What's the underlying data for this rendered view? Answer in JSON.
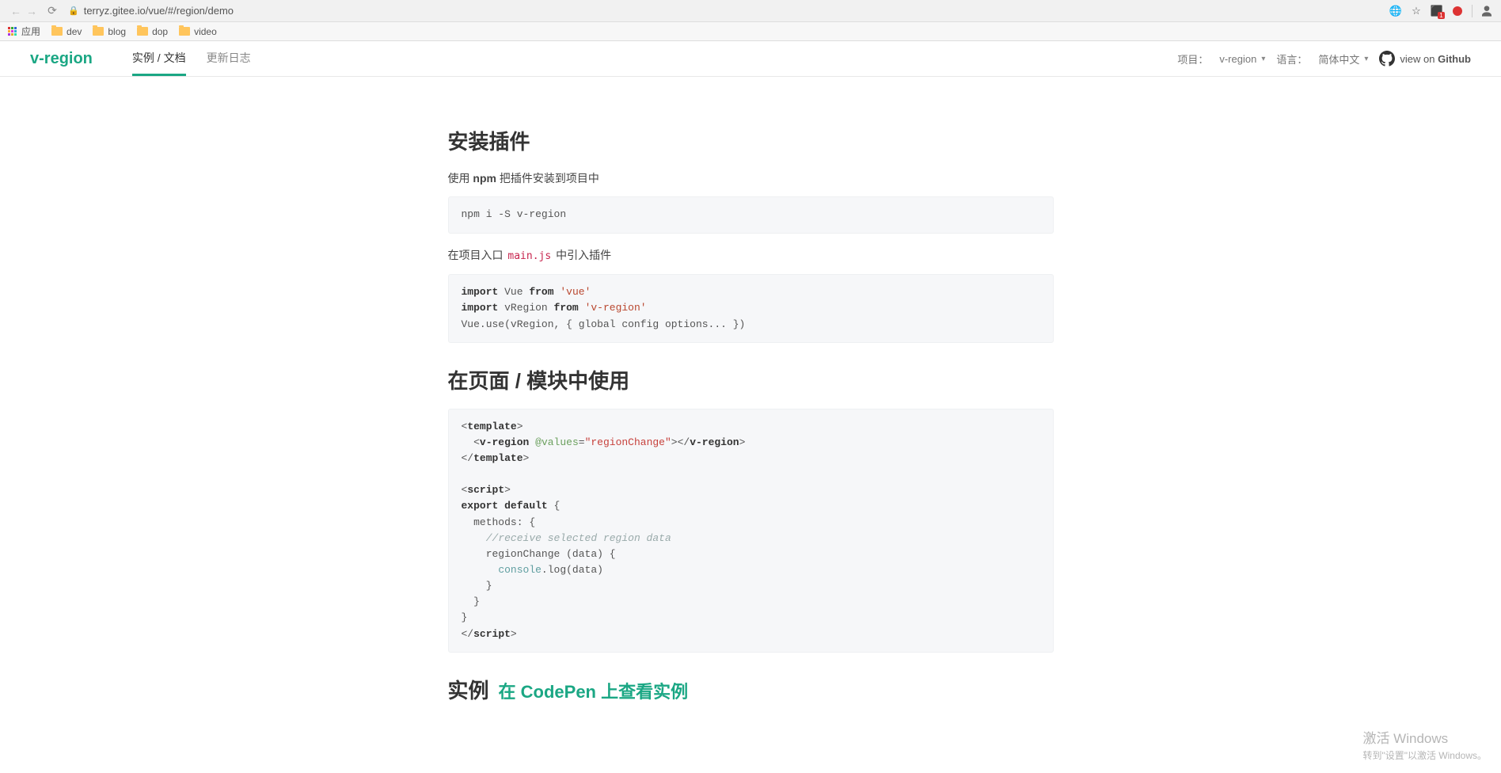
{
  "browser": {
    "url": "terryz.gitee.io/vue/#/region/demo",
    "apps_label": "应用",
    "bookmarks": [
      "dev",
      "blog",
      "dop",
      "video"
    ],
    "ext_badge": "1"
  },
  "header": {
    "brand": "v-region",
    "tabs": [
      {
        "label": "实例 / 文档",
        "active": true
      },
      {
        "label": "更新日志",
        "active": false
      }
    ],
    "project_label": "项目：",
    "project_value": "v-region",
    "lang_label": "语言：",
    "lang_value": "简体中文",
    "github_prefix": "view on ",
    "github_bold": "Github"
  },
  "sections": {
    "install": {
      "title": "安装插件",
      "desc1_pre": "使用 ",
      "desc1_bold": "npm",
      "desc1_post": " 把插件安装到项目中",
      "code1": "npm i -S v-region",
      "desc2_pre": "在项目入口 ",
      "desc2_code": "main.js",
      "desc2_post": " 中引入插件"
    },
    "usage": {
      "title": "在页面 / 模块中使用"
    },
    "example": {
      "title": "实例",
      "link_pre": "在 ",
      "link_bold": "CodePen",
      "link_post": " 上查看实例"
    }
  },
  "watermark": {
    "l1": "激活 Windows",
    "l2": "转到\"设置\"以激活 Windows。"
  }
}
